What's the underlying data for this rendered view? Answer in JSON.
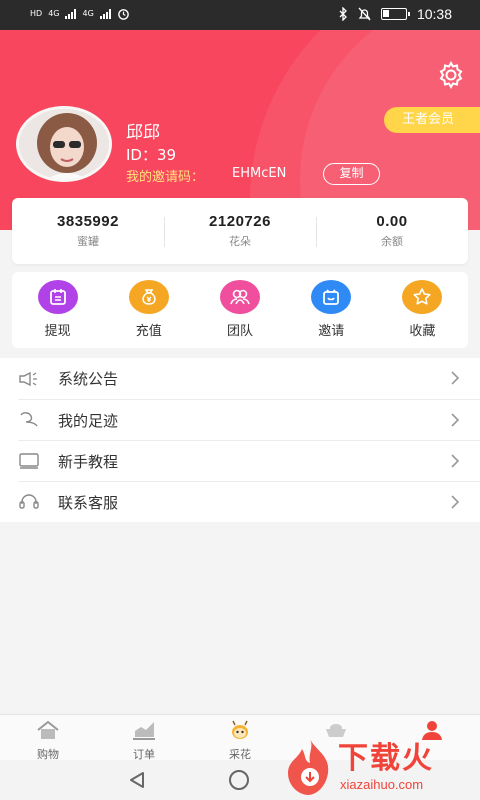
{
  "status_bar": {
    "time": "10:38",
    "left_tags": [
      "HD",
      "4G",
      "4G"
    ]
  },
  "profile": {
    "name": "邱邱",
    "id_text": "ID：39",
    "invite_label": "我的邀请码：",
    "invite_code": "EHMcEN",
    "copy_label": "复制",
    "vip_label": "王者会员"
  },
  "stats": [
    {
      "value": "3835992",
      "label": "蜜罐"
    },
    {
      "value": "2120726",
      "label": "花朵"
    },
    {
      "value": "0.00",
      "label": "余额"
    }
  ],
  "actions": [
    {
      "label": "提现",
      "icon": "withdraw-icon",
      "color": "#b042e8"
    },
    {
      "label": "充值",
      "icon": "money-bag-icon",
      "color": "#f5a623"
    },
    {
      "label": "团队",
      "icon": "team-icon",
      "color": "#ef4f9c"
    },
    {
      "label": "邀请",
      "icon": "invite-icon",
      "color": "#2f8af5"
    },
    {
      "label": "收藏",
      "icon": "star-icon",
      "color": "#f5a623"
    }
  ],
  "menu": [
    {
      "label": "系统公告",
      "icon": "announcement-icon"
    },
    {
      "label": "我的足迹",
      "icon": "footprint-icon"
    },
    {
      "label": "新手教程",
      "icon": "tutorial-icon"
    },
    {
      "label": "联系客服",
      "icon": "headset-icon"
    }
  ],
  "tabs": [
    {
      "label": "购物",
      "icon": "home-icon"
    },
    {
      "label": "订单",
      "icon": "chart-icon"
    },
    {
      "label": "采花",
      "icon": "bee-icon"
    },
    {
      "label": "",
      "icon": "ingot-icon"
    },
    {
      "label": "",
      "icon": "profile-icon"
    }
  ],
  "watermark": {
    "title": "下载火",
    "subtitle": "xiazaihuo.com"
  },
  "colors": {
    "header_bg": "#f7465e",
    "vip_badge": "#ffd54a",
    "invite_label": "#ffe37a",
    "active_tab": "#f0443a"
  }
}
